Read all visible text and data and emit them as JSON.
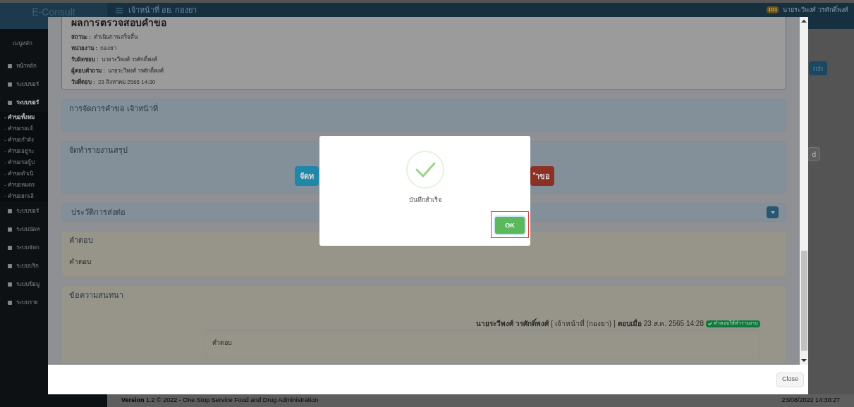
{
  "header": {
    "brand": "E-Consult",
    "title": "เจ้าหน้าที่ อย. กองยา",
    "badge": "101",
    "user": "นายระวีพงศ์ วรศักดิ์พงศ์"
  },
  "sidebar": {
    "heading": "เมนูหลัก",
    "items": [
      {
        "label": "หน้าหลัก",
        "kind": "menu",
        "selected": false
      },
      {
        "label": "ระบบขอรั",
        "kind": "menu",
        "selected": false
      },
      {
        "label": "ระบบขอรั",
        "kind": "menu",
        "selected": true
      },
      {
        "label": "- คำขอทั้งหม",
        "kind": "sub",
        "selected": true
      },
      {
        "label": "- คำขอรอเจ้",
        "kind": "sub",
        "selected": false
      },
      {
        "label": "- คำขอกำลัง",
        "kind": "sub",
        "selected": false
      },
      {
        "label": "- คำขออยู่ระ",
        "kind": "sub",
        "selected": false
      },
      {
        "label": "- คำขอรอผู้ป",
        "kind": "sub",
        "selected": false
      },
      {
        "label": "- คำขอดำเนิ",
        "kind": "sub",
        "selected": false
      },
      {
        "label": "- คำขอหมดร",
        "kind": "sub",
        "selected": false
      },
      {
        "label": "- คำขอยกเลิ",
        "kind": "sub",
        "selected": false
      },
      {
        "label": "ระบบขอรั",
        "kind": "menu",
        "selected": false
      },
      {
        "label": "ระบบนัดห",
        "kind": "menu",
        "selected": false
      },
      {
        "label": "ระบบจัดก",
        "kind": "menu",
        "selected": false
      },
      {
        "label": "ระบบบริก",
        "kind": "menu",
        "selected": false
      },
      {
        "label": "ระบบข้อมู",
        "kind": "menu",
        "selected": false
      },
      {
        "label": "ระบบราย",
        "kind": "menu",
        "selected": false
      }
    ]
  },
  "background_page": {
    "search_button": "rch",
    "button_2": "d"
  },
  "footer": {
    "version_label": "Version",
    "version_text": "1.2 © 2022 - One Stop Service Food and Drug Administration",
    "timestamp": "23/08/2022 14:30:27"
  },
  "modal": {
    "result": {
      "title": "ผลการตรวจสอบคำขอ",
      "fields": [
        {
          "label": "สถานะ :",
          "value": "ดำเนินการเสร็จสิ้น"
        },
        {
          "label": "หน่วยงาน :",
          "value": "กองยา"
        },
        {
          "label": "รับผิดชอบ :",
          "value": "นายระวีพงศ์ วรศักดิ์พงศ์"
        },
        {
          "label": "ผู้ตอบคำถาม :",
          "value": "นายระวีพงศ์ วรศักดิ์พงศ์"
        },
        {
          "label": "วันที่ตอบ :",
          "value": "23 สิงหาคม 2565 14:30"
        }
      ]
    },
    "panels": [
      {
        "kind": "info",
        "title": "การจัดการคำขอ เจ้าหน้าที่"
      },
      {
        "kind": "info",
        "title": "จัดทำรายงานสรุป",
        "buttons": [
          {
            "label": "จัดท",
            "kind": "primary"
          },
          {
            "label": "ำขอ",
            "kind": "danger"
          }
        ]
      },
      {
        "kind": "info",
        "title": "ประวัติการส่งต่อ",
        "expanded": false
      },
      {
        "kind": "warning",
        "title": "คำตอบ",
        "body": "คำตอบ"
      },
      {
        "kind": "warning",
        "title": "ข้อความสนทนา",
        "message": {
          "author": "นายระวีพงศ์ วรศักดิ์พงศ์",
          "role": "[ เจ้าหน้าที่ (กองยา) ]",
          "answered_label": "ตอบเมื่อ",
          "time": "23 ส.ค. 2565 14:28",
          "tag": "คำตอบใช้ทำรายงาน",
          "body": "คำตอบ"
        }
      }
    ],
    "close_button": "Close"
  },
  "dialog": {
    "message": "บันทึกสำเร็จ",
    "ok_button": "OK",
    "highlighted": true
  }
}
